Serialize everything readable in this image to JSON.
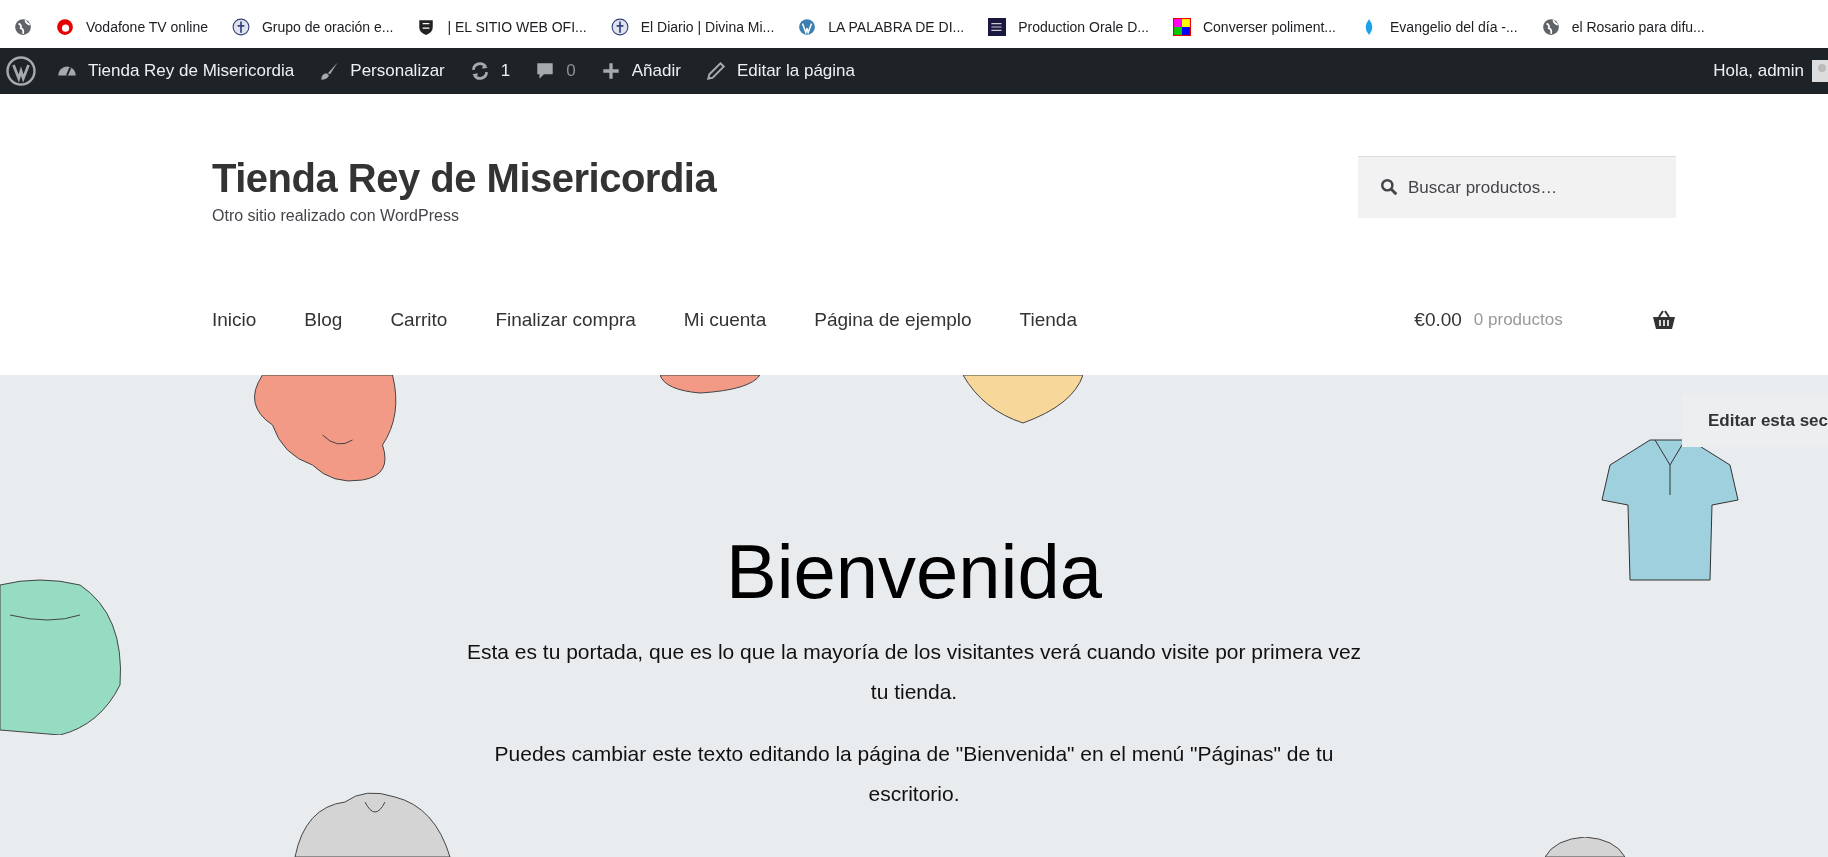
{
  "bookmarks": [
    {
      "label": "Vodafone TV online"
    },
    {
      "label": "Grupo de oración e..."
    },
    {
      "label": "| EL SITIO WEB OFI..."
    },
    {
      "label": "El Diario | Divina Mi..."
    },
    {
      "label": "LA PALABRA DE DI..."
    },
    {
      "label": "Production Orale D..."
    },
    {
      "label": "Converser poliment..."
    },
    {
      "label": "Evangelio del día -..."
    },
    {
      "label": "el Rosario para difu..."
    }
  ],
  "admin_bar": {
    "items": [
      {
        "kind": "site",
        "label": "Tienda Rey de Misericordia"
      },
      {
        "kind": "customize",
        "label": "Personalizar"
      },
      {
        "kind": "updates",
        "label": "1"
      },
      {
        "kind": "comments",
        "label": "0"
      },
      {
        "kind": "new",
        "label": "Añadir"
      },
      {
        "kind": "edit",
        "label": "Editar la página"
      }
    ],
    "greeting": "Hola, admin"
  },
  "header": {
    "site_title": "Tienda Rey de Misericordia",
    "tagline": "Otro sitio realizado con WordPress",
    "search": {
      "placeholder": "Buscar productos…"
    }
  },
  "nav": {
    "items": [
      "Inicio",
      "Blog",
      "Carrito",
      "Finalizar compra",
      "Mi cuenta",
      "Página de ejemplo",
      "Tienda"
    ],
    "cart": {
      "total": "€0.00",
      "count": "0 productos"
    }
  },
  "hero": {
    "edit_button": "Editar esta sec",
    "title": "Bienvenida",
    "paragraphs": [
      "Esta es tu portada, que es lo que la mayoría de los visitantes verá cuando visite por primera vez tu tienda.",
      "Puedes cambiar este texto editando la página de \"Bienvenida\" en el menú \"Páginas\" de tu escritorio."
    ]
  }
}
